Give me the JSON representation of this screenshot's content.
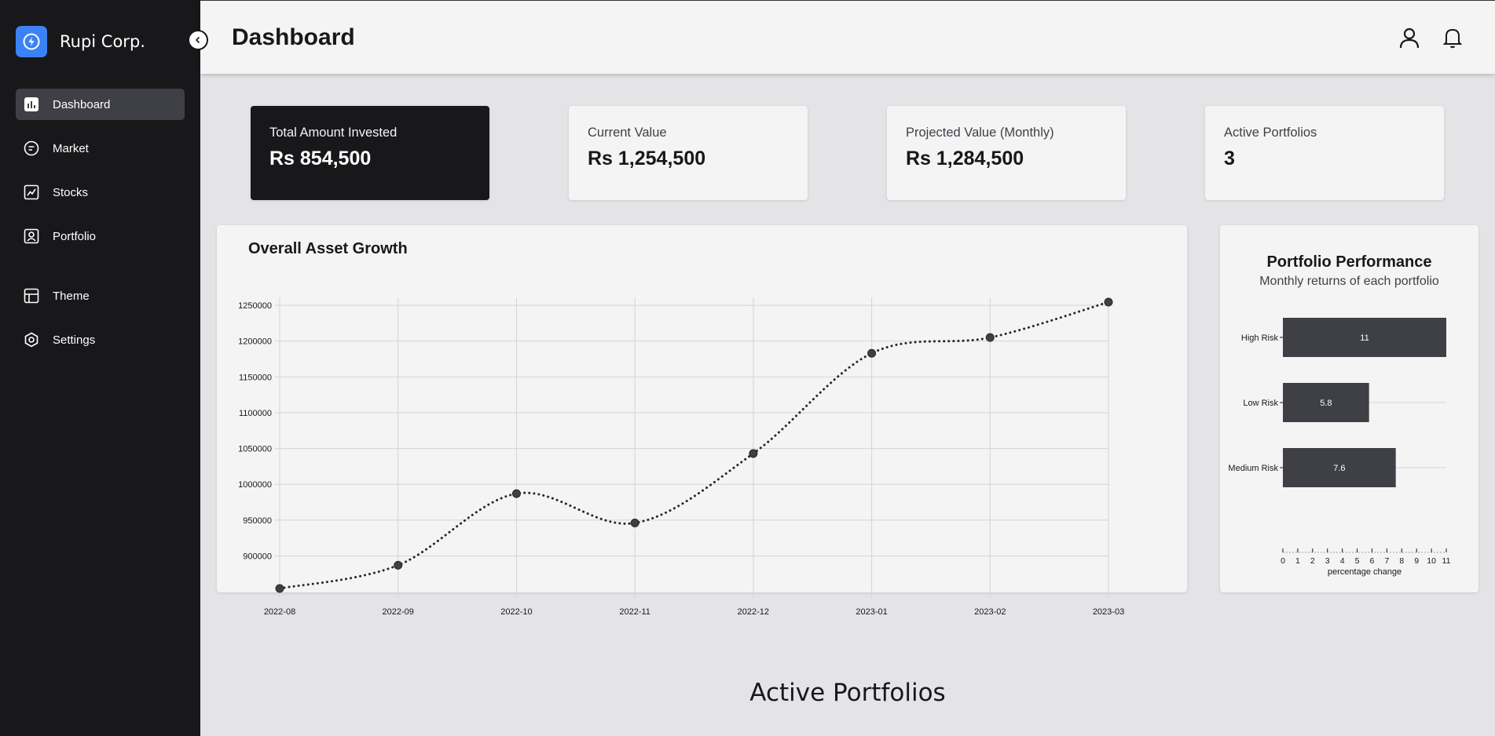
{
  "brand": {
    "name": "Rupi Corp.",
    "logo_icon": "lightning-icon",
    "accent": "#3b82f6"
  },
  "sidebar": {
    "items": [
      {
        "label": "Dashboard",
        "icon": "bar-chart-icon",
        "active": true
      },
      {
        "label": "Market",
        "icon": "market-icon",
        "active": false
      },
      {
        "label": "Stocks",
        "icon": "line-chart-icon",
        "active": false
      },
      {
        "label": "Portfolio",
        "icon": "portfolio-icon",
        "active": false
      },
      {
        "label": "Theme",
        "icon": "theme-icon",
        "active": false
      },
      {
        "label": "Settings",
        "icon": "gear-icon",
        "active": false
      }
    ]
  },
  "header": {
    "title": "Dashboard",
    "icons": [
      "user-icon",
      "bell-icon"
    ]
  },
  "stats": [
    {
      "label": "Total Amount Invested",
      "value": "Rs 854,500",
      "highlight": true
    },
    {
      "label": "Current Value",
      "value": "Rs 1,254,500",
      "highlight": false
    },
    {
      "label": "Projected Value (Monthly)",
      "value": "Rs 1,284,500",
      "highlight": false
    },
    {
      "label": "Active Portfolios",
      "value": "3",
      "highlight": false
    }
  ],
  "growth_panel": {
    "title": "Overall Asset Growth"
  },
  "performance_panel": {
    "title": "Portfolio Performance",
    "subtitle": "Monthly returns of each portfolio"
  },
  "section": {
    "title": "Active Portfolios"
  },
  "chart_data": [
    {
      "type": "line",
      "title": "Overall Asset Growth",
      "curve": "smooth",
      "line_style": "dotted",
      "x": [
        "2022-08",
        "2022-09",
        "2022-10",
        "2022-11",
        "2022-12",
        "2023-01",
        "2023-02",
        "2023-03"
      ],
      "series": [
        {
          "values": [
            854500,
            887000,
            987000,
            946000,
            1043000,
            1183000,
            1205000,
            1254500
          ]
        }
      ],
      "yticks": [
        900000,
        950000,
        1000000,
        1050000,
        1100000,
        1150000,
        1200000,
        1250000
      ],
      "ylim": [
        854500,
        1254500
      ],
      "grid": true,
      "color": "#27272a"
    },
    {
      "type": "bar",
      "orientation": "horizontal",
      "categories": [
        "High Risk",
        "Low Risk",
        "Medium Risk"
      ],
      "values": [
        11,
        5.8,
        7.6
      ],
      "xlabel": "percentage change",
      "xticks": [
        0,
        1,
        2,
        3,
        4,
        5,
        6,
        7,
        8,
        9,
        10,
        11
      ],
      "xlim": [
        0,
        11
      ],
      "grid": true,
      "color": "#3f3f46"
    }
  ]
}
